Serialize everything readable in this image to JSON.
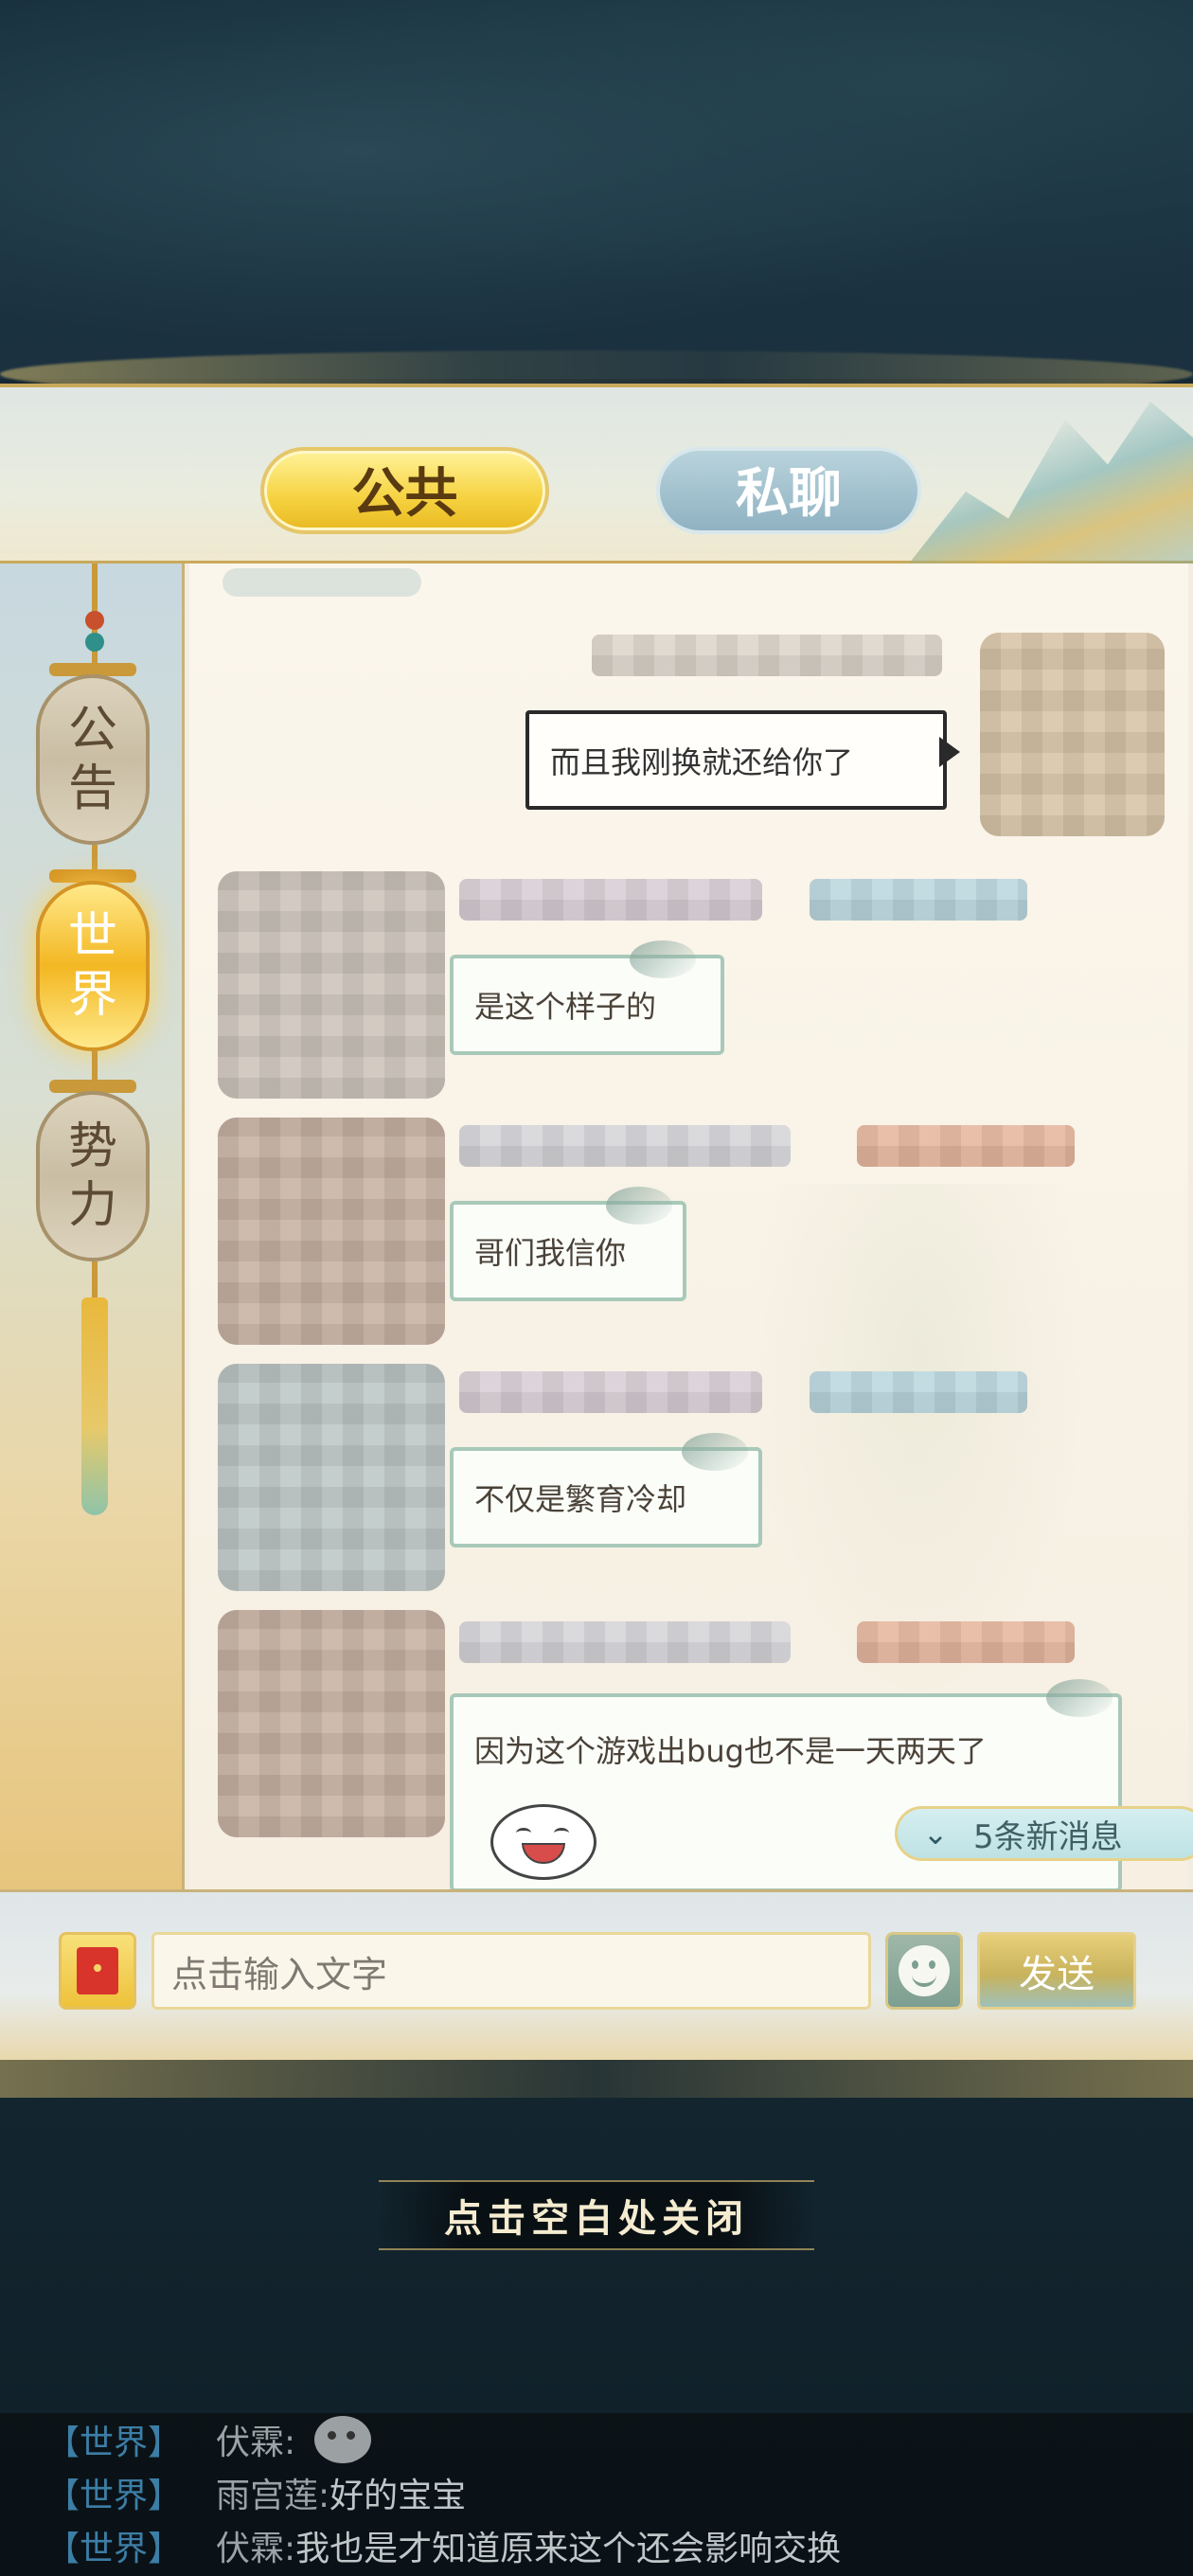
{
  "tabs": {
    "public": "公共",
    "private": "私聊"
  },
  "sidebar": {
    "items": [
      {
        "label_1": "公",
        "label_2": "告",
        "active": false
      },
      {
        "label_1": "世",
        "label_2": "界",
        "active": true
      },
      {
        "label_1": "势",
        "label_2": "力",
        "active": false
      }
    ]
  },
  "messages": [
    {
      "from": "self",
      "text": "而且我刚换就还给你了"
    },
    {
      "from": "other",
      "text": "是这个样子的"
    },
    {
      "from": "other",
      "text": "哥们我信你"
    },
    {
      "from": "other",
      "text": "不仅是繁育冷却"
    },
    {
      "from": "other",
      "text": "因为这个游戏出bug也不是一天两天了"
    }
  ],
  "new_messages": {
    "icon": "double-chevron-down-icon",
    "label": "5条新消息"
  },
  "input": {
    "placeholder": "点击输入文字",
    "send_label": "发送"
  },
  "close_hint": "点击空白处关闭",
  "ticker": [
    {
      "tag": "【世界】",
      "name": "伏霖:",
      "text": ""
    },
    {
      "tag": "【世界】",
      "name": "雨宫莲:",
      "text": "好的宝宝"
    },
    {
      "tag": "【世界】",
      "name": "伏霖:",
      "text": "我也是才知道原来这个还会影响交换"
    }
  ]
}
